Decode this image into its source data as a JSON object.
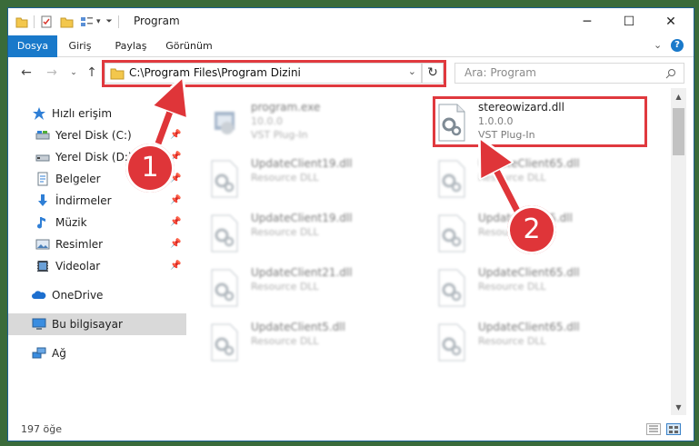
{
  "window": {
    "title": "Program"
  },
  "ribbon": {
    "tabs": [
      {
        "label": "Dosya",
        "active": true
      },
      {
        "label": "Giriş",
        "active": false
      },
      {
        "label": "Paylaş",
        "active": false
      },
      {
        "label": "Görünüm",
        "active": false
      }
    ],
    "help": "?"
  },
  "nav": {
    "address": "C:\\Program Files\\Program Dizini",
    "search_placeholder": "Ara: Program"
  },
  "sidebar": {
    "items": [
      {
        "label": "Hızlı erişim",
        "icon": "star-icon",
        "pinned": false
      },
      {
        "label": "Yerel Disk (C:)",
        "icon": "drive-icon",
        "pinned": true
      },
      {
        "label": "Yerel Disk (D:)",
        "icon": "drive-icon",
        "pinned": true
      },
      {
        "label": "Belgeler",
        "icon": "documents-icon",
        "pinned": true
      },
      {
        "label": "İndirmeler",
        "icon": "download-icon",
        "pinned": true
      },
      {
        "label": "Müzik",
        "icon": "music-icon",
        "pinned": true
      },
      {
        "label": "Resimler",
        "icon": "pictures-icon",
        "pinned": true
      },
      {
        "label": "Videolar",
        "icon": "video-icon",
        "pinned": true
      },
      {
        "label": "OneDrive",
        "icon": "cloud-icon",
        "pinned": false
      },
      {
        "label": "Bu bilgisayar",
        "icon": "computer-icon",
        "pinned": false,
        "selected": true
      },
      {
        "label": "Ağ",
        "icon": "network-icon",
        "pinned": false
      }
    ]
  },
  "files": [
    {
      "name": "program.exe",
      "line2": "10.0.0",
      "line3": "VST Plug-In",
      "type": "exe"
    },
    {
      "name": "stereowizard.dll",
      "line2": "1.0.0.0",
      "line3": "VST Plug-In",
      "type": "dll",
      "highlighted": true
    },
    {
      "name": "UpdateClient19.dll",
      "line2": "Resource DLL",
      "type": "dll"
    },
    {
      "name": "UpdateClient65.dll",
      "line2": "Resource DLL",
      "type": "dll"
    },
    {
      "name": "UpdateClient19.dll",
      "line2": "Resource DLL",
      "type": "dll"
    },
    {
      "name": "UpdateClient5.dll",
      "line2": "Resource DLL",
      "type": "dll"
    },
    {
      "name": "UpdateClient21.dll",
      "line2": "Resource DLL",
      "type": "dll"
    },
    {
      "name": "UpdateClient65.dll",
      "line2": "Resource DLL",
      "type": "dll"
    },
    {
      "name": "UpdateClient5.dll",
      "line2": "Resource DLL",
      "type": "dll"
    },
    {
      "name": "UpdateClient65.dll",
      "line2": "Resource DLL",
      "type": "dll"
    }
  ],
  "status": {
    "item_count": "197 öğe"
  },
  "annotations": {
    "badge1": "1",
    "badge2": "2",
    "color": "#df3539"
  }
}
